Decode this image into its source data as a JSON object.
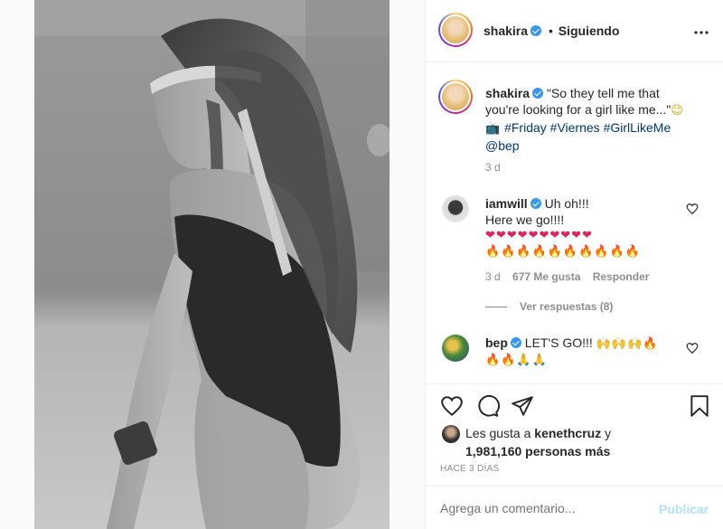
{
  "header": {
    "username": "shakira",
    "separator": "•",
    "follow_status": "Siguiendo",
    "more_icon": "more-horizontal-icon"
  },
  "caption": {
    "username": "shakira",
    "text_line1": "\"So they tell me that",
    "text_line2": "you're looking for a girl like me...\"",
    "wink_emoji": "😉",
    "tv_emoji": "📺",
    "hashtags": [
      "#Friday",
      "#Viernes",
      "#GirlLikeMe"
    ],
    "mention": "@bep",
    "time": "3 d"
  },
  "comments": [
    {
      "username": "iamwill",
      "line1": "Uh oh!!!",
      "line2": "Here we go!!!!",
      "hearts": "❤❤❤❤❤❤❤❤❤❤",
      "fires": "🔥🔥🔥🔥🔥🔥🔥🔥🔥🔥",
      "time": "3 d",
      "likes": "677 Me gusta",
      "reply": "Responder",
      "view_replies": "Ver respuestas (8)"
    },
    {
      "username": "bep",
      "text": "LET'S GO!!!",
      "emoji_line1": "🙌🙌🙌🔥",
      "emoji_line2": "🔥🔥🙏🙏"
    }
  ],
  "actions": {
    "icons": [
      "heart-icon",
      "comment-icon",
      "share-icon",
      "bookmark-icon"
    ]
  },
  "likes": {
    "prefix": "Les gusta a",
    "user": "kenethcruz",
    "joiner": "y",
    "count": "1,981,160 personas más"
  },
  "timestamp": "HACE 3 DÍAS",
  "comment_box": {
    "placeholder": "Agrega un comentario...",
    "publish": "Publicar"
  },
  "colors": {
    "verified": "#3897f0",
    "link": "#00376b",
    "publish_disabled": "#b2dffc",
    "muted": "#8e8e8e"
  }
}
